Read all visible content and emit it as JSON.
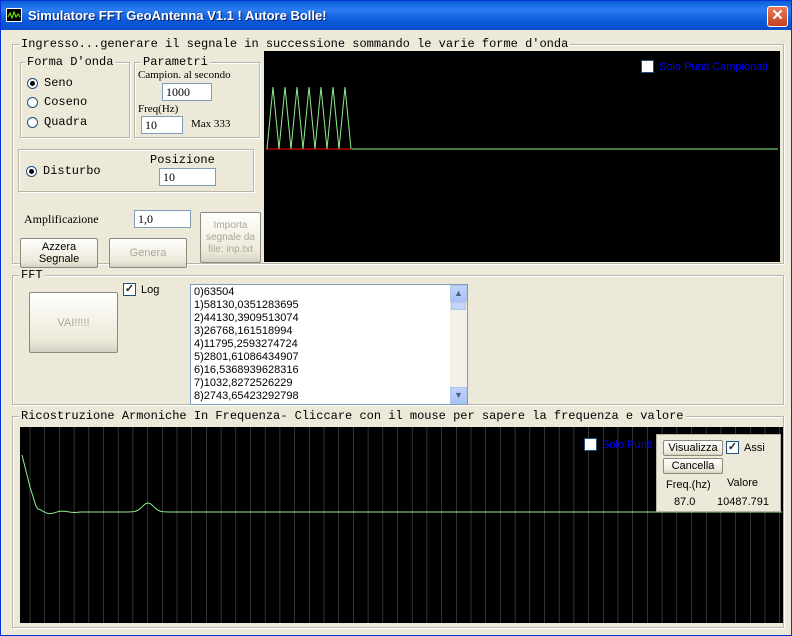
{
  "window": {
    "title": "Simulatore FFT GeoAntenna V1.1 ! Autore Bolle!",
    "close_glyph": "✕",
    "icon": "waveform-icon"
  },
  "input_group": {
    "title": "Ingresso...generare il segnale in successione sommando le varie forme d'onda",
    "waveform": {
      "title": "Forma D'onda",
      "options": [
        {
          "label": "Seno",
          "selected": true
        },
        {
          "label": "Coseno",
          "selected": false
        },
        {
          "label": "Quadra",
          "selected": false
        }
      ]
    },
    "params": {
      "title": "Parametri",
      "rate_label": "Campion. al secondo",
      "rate_value": "1000",
      "freq_label": "Freq(Hz)",
      "freq_value": "10",
      "max_label": "Max 333"
    },
    "noise": {
      "label": "Disturbo",
      "selected": true,
      "position_label": "Posizione",
      "position_value": "10"
    },
    "amplification": {
      "label": "Amplificazione",
      "value": "1,0"
    },
    "reset_button": "Azzera\nSegnale",
    "generate_button": "Genera",
    "import_button": "Importa\nsegnale da\nfile: inp.txt",
    "samples_only": {
      "label": "Solo Punti Campionati",
      "checked": false
    }
  },
  "fft_group": {
    "title": "FFT",
    "go_button": "VAI!!!!!",
    "log": {
      "label": "Log",
      "checked": true
    },
    "results": [
      "0)63504",
      "1)58130,0351283695",
      "2)44130,3909513074",
      "3)26768,161518994",
      "4)11795,2593274724",
      "5)2801,61086434907",
      "6)16,5368939628316",
      "7)1032,8272526229",
      "8)2743,65423292798"
    ]
  },
  "harmonics_group": {
    "title": "Ricostruzione Armoniche In Frequenza- Cliccare con il mouse per sapere la frequenza e valore",
    "only_points": {
      "label": "Solo Punti",
      "checked": false
    },
    "show_button": "Visualizza",
    "cancel_button": "Cancella",
    "axes": {
      "label": "Assi",
      "checked": true
    },
    "freq_label": "Freq.(hz)",
    "value_label": "Valore",
    "freq_value": "87.0",
    "value_value": "10487.791"
  },
  "colors": {
    "signal": "#90ee90",
    "baseline": "#ff0000",
    "plot_bg": "#000000",
    "grid": "#555555",
    "link_text": "#0000ff"
  }
}
